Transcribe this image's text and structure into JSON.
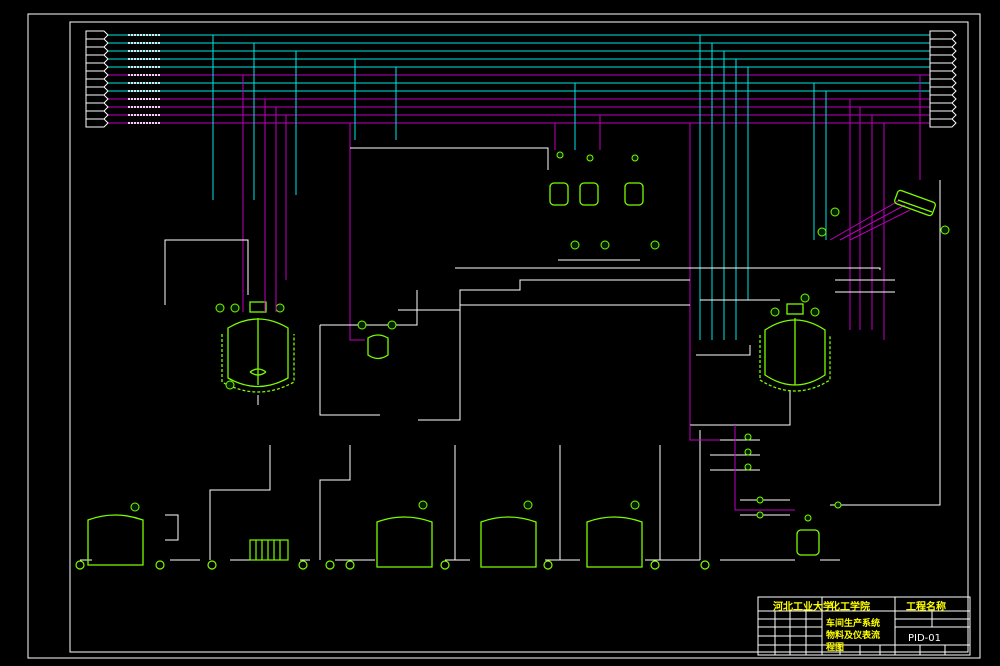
{
  "colors": {
    "background": "#000000",
    "border": "#ffffff",
    "equipment": "#7cfc00",
    "pipe_cyan": "#00e5e5",
    "pipe_magenta": "#c000c0",
    "pipe_white": "#ffffff",
    "instrument": "#7cfc00",
    "title_text": "#ffff00"
  },
  "title_block": {
    "school": "河北工业大学",
    "department": "化工学院",
    "project": "工程名称",
    "drawing_title": "车间生产系统物料及仪表流程图",
    "drawing_no": "PID-01"
  },
  "icons": [
    "reactor-icon",
    "storage-tank-icon",
    "pump-icon",
    "heat-exchanger-icon",
    "condenser-icon",
    "instrument-bubble-icon",
    "valve-icon",
    "filter-icon"
  ]
}
